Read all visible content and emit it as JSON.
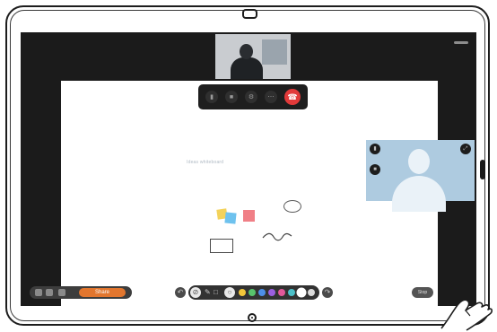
{
  "device": {
    "camera_icon": "camera-icon",
    "home_button_icon": "home-button-icon"
  },
  "meeting": {
    "self_view": {
      "description_icon": "self-view-video"
    },
    "controls": {
      "icons": [
        "microphone-icon",
        "video-camera-icon",
        "settings-icon",
        "more-icon",
        "end-call-icon"
      ],
      "end_call_color": "#e23a3a"
    },
    "remote_participant": {
      "tile_color": "#aecbe0"
    }
  },
  "whiteboard": {
    "text": "Ideas whiteboard",
    "sticky_colors": [
      "#f3d25a",
      "#6ec2ee",
      "#f07f86"
    ]
  },
  "bottom_bar": {
    "share_label": "Share",
    "stop_label": "Stop",
    "swatch_colors": [
      "#ffffff",
      "#f3c73a",
      "#58c36d",
      "#4d8fe8",
      "#9b5fe0",
      "#e2589a",
      "#4cc0c9",
      "#ffffff"
    ],
    "accent_color": "#e2762e"
  }
}
